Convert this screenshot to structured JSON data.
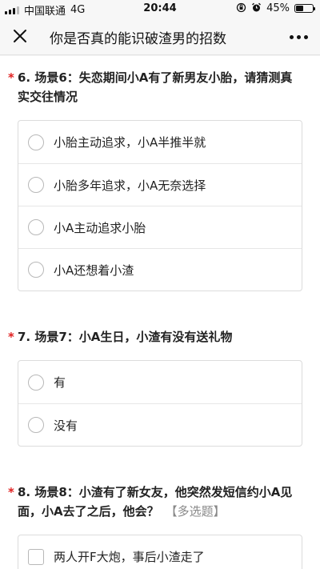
{
  "status_bar": {
    "carrier": "中国联通",
    "network": "4G",
    "time": "20:44",
    "battery_percent": "45%",
    "battery_level": 0.45,
    "icons": [
      "signal-icon",
      "lock-rotation-icon",
      "alarm-icon",
      "battery-icon"
    ]
  },
  "nav": {
    "title": "你是否真的能识破渣男的招数",
    "close_icon": "close-icon",
    "more_icon": "more-icon"
  },
  "questions": [
    {
      "required_mark": "*",
      "title": "6. 场景6：失恋期间小A有了新男友小胎，请猜测真实交往情况",
      "type": "radio",
      "options": [
        "小胎主动追求，小A半推半就",
        "小胎多年追求，小A无奈选择",
        "小A主动追求小胎",
        "小A还想着小渣"
      ]
    },
    {
      "required_mark": "*",
      "title": "7. 场景7：小A生日，小渣有没有送礼物",
      "type": "radio",
      "options": [
        "有",
        "没有"
      ]
    },
    {
      "required_mark": "*",
      "title": "8. 场景8：小渣有了新女友，他突然发短信约小A见面，小A去了之后，他会？",
      "tag": "【多选题】",
      "type": "checkbox",
      "options": [
        "两人开F大炮，事后小渣走了"
      ]
    }
  ],
  "colors": {
    "required": "#e02020",
    "border": "#dcdcdc",
    "tag": "#888888"
  }
}
